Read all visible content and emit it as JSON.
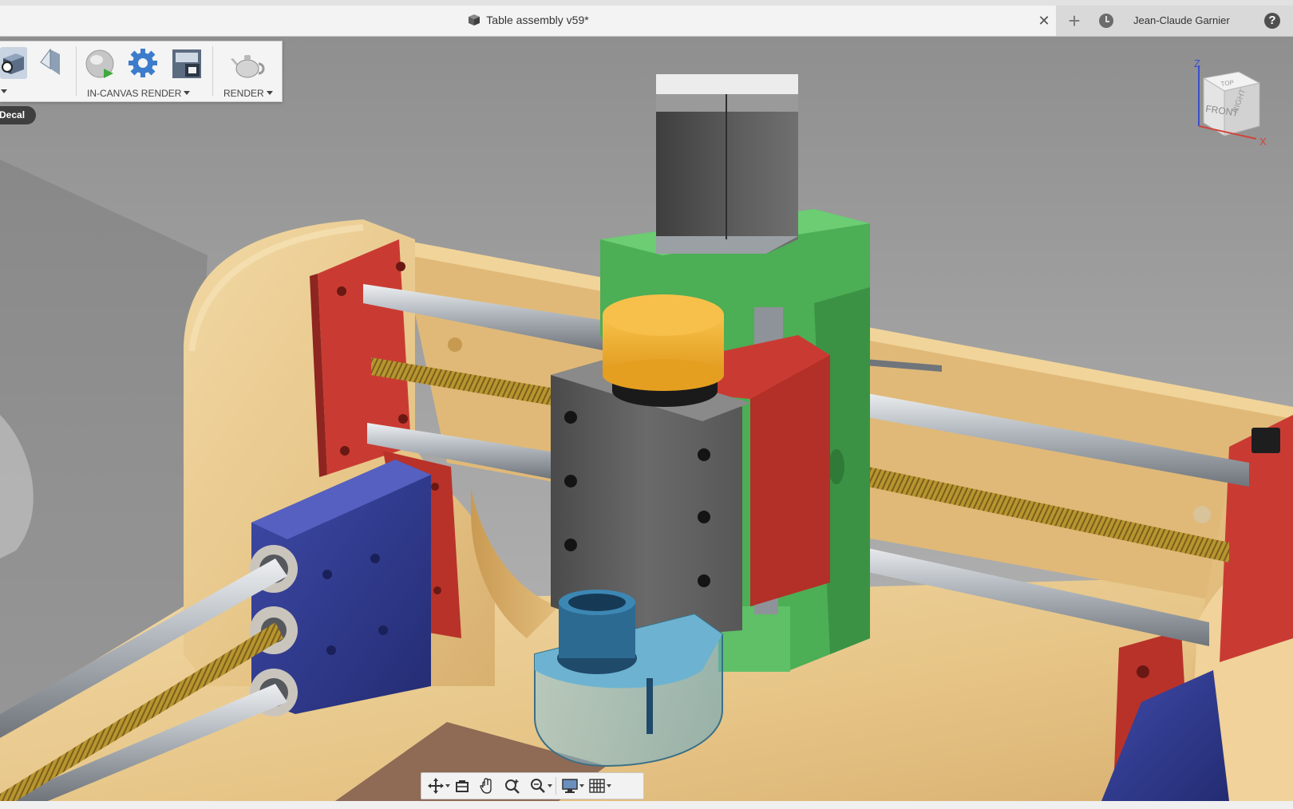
{
  "window": {
    "tab_title": "Table assembly v59*",
    "tab_icon": "document-cube-icon",
    "close_symbol": "✕",
    "add_symbol": "+",
    "user_name": "Jean-Claude Garnier",
    "help_symbol": "?"
  },
  "toolbar": {
    "in_canvas_render_label": "IN-CANVAS RENDER",
    "render_label": "RENDER",
    "decal_label": "Decal"
  },
  "viewcube": {
    "face_front": "FRONT",
    "face_right": "RIGHT",
    "face_top": "TOP",
    "axis_z": "Z",
    "axis_x": "X"
  },
  "colors": {
    "wood": "#e8c98a",
    "red_plate": "#c93b32",
    "blue_block": "#2e3a8c",
    "green_carriage": "#4cae55",
    "gray_spindle": "#5a5a5a",
    "yellow_cap": "#f2b12e",
    "steel_rod": "#b9bec4",
    "lead_screw": "#b9962f"
  },
  "navbar": {
    "items": [
      "orbit-icon",
      "look-at-icon",
      "pan-icon",
      "zoom-icon",
      "zoom-window-icon",
      "display-settings-icon",
      "grid-settings-icon"
    ]
  }
}
